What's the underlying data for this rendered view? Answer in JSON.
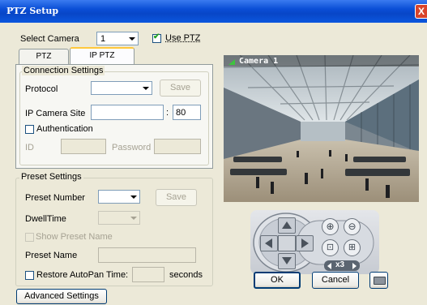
{
  "window": {
    "title": "PTZ Setup",
    "close_label": "X"
  },
  "camera": {
    "select_label": "Select Camera",
    "selected": "1",
    "use_ptz_label": "Use PTZ",
    "use_ptz_checked": true
  },
  "tabs": [
    {
      "label": "PTZ",
      "active": false
    },
    {
      "label": "IP PTZ",
      "active": true
    }
  ],
  "connection": {
    "group_title": "Connection Settings",
    "protocol_label": "Protocol",
    "protocol_value": "",
    "save_label": "Save",
    "ip_site_label": "IP Camera Site",
    "ip_site_value": "",
    "port_separator": ":",
    "port_value": "80",
    "auth_label": "Authentication",
    "auth_checked": false,
    "id_label": "ID",
    "id_value": "",
    "password_label": "Password",
    "password_value": ""
  },
  "preset": {
    "group_title": "Preset Settings",
    "number_label": "Preset Number",
    "number_value": "",
    "save_label": "Save",
    "dwell_label": "DwellTime",
    "dwell_value": "",
    "show_name_label": "Show Preset Name",
    "name_label": "Preset Name",
    "name_value": "",
    "restore_label": "Restore AutoPan Time:",
    "restore_value": "",
    "seconds_label": "seconds"
  },
  "advanced_label": "Advanced Settings",
  "preview": {
    "caption": "Camera 1"
  },
  "ptz_control": {
    "zoom_text": "x3"
  },
  "buttons": {
    "ok": "OK",
    "cancel": "Cancel"
  },
  "colors": {
    "titlebar": "#0a4ed6",
    "dialog_bg": "#ece9d8",
    "tab_highlight": "#ffc83c",
    "check_mark": "#21a121"
  }
}
